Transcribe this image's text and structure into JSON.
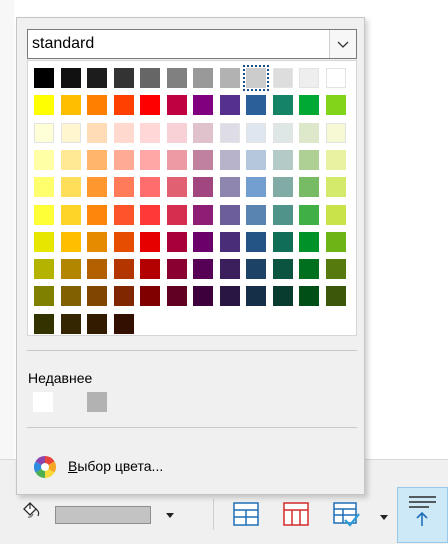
{
  "palette_selector": {
    "value": "standard",
    "chevron_icon": "chevron-down-icon"
  },
  "swatches": [
    [
      "#000000",
      "#111111",
      "#1c1c1c",
      "#333333",
      "#666666",
      "#808080",
      "#999999",
      "#b2b2b2",
      "#cccccc",
      "#dddddd",
      "#eeeeee",
      "#ffffff"
    ],
    [
      "#ffff00",
      "#ffbf00",
      "#ff8000",
      "#ff4000",
      "#ff0000",
      "#bf0041",
      "#800080",
      "#55308d",
      "#2a6099",
      "#158466",
      "#00a933",
      "#81d41a"
    ],
    [
      "#ffffd7",
      "#fff5ce",
      "#ffdbb6",
      "#ffd8ce",
      "#ffd7d7",
      "#f7d1d5",
      "#e0c2cd",
      "#dedce6",
      "#dee6ef",
      "#dee7e5",
      "#dde8cb",
      "#f6f9d4"
    ],
    [
      "#ffffa6",
      "#ffe994",
      "#ffb66c",
      "#ffaa95",
      "#ffa6a6",
      "#ec9ba4",
      "#bf819e",
      "#b7b3ca",
      "#b4c7dc",
      "#b3cac7",
      "#afd095",
      "#e8f2a1"
    ],
    [
      "#ffff6d",
      "#ffde59",
      "#ff972f",
      "#ff7b59",
      "#ff6d6d",
      "#e16173",
      "#a1467e",
      "#8e86ae",
      "#729fcf",
      "#81aca6",
      "#77bc65",
      "#d4ea6b"
    ],
    [
      "#ffff38",
      "#ffd428",
      "#ff860d",
      "#ff5429",
      "#ff3838",
      "#d62e4e",
      "#8d1d75",
      "#6b5e9b",
      "#5983b0",
      "#50938a",
      "#3faf46",
      "#c9e44b"
    ],
    [
      "#e6e600",
      "#ffbf00",
      "#e68a00",
      "#e64d00",
      "#e60000",
      "#a8003b",
      "#6b006b",
      "#4a2d78",
      "#245385",
      "#0f6e55",
      "#009129",
      "#6db514"
    ],
    [
      "#b3b300",
      "#b38600",
      "#b36000",
      "#b33600",
      "#b30000",
      "#8a0030",
      "#560056",
      "#3b1f5c",
      "#1c4266",
      "#0b5440",
      "#00701f",
      "#567a0e"
    ],
    [
      "#808000",
      "#806000",
      "#804500",
      "#802700",
      "#800000",
      "#610022",
      "#3d003d",
      "#2a1642",
      "#142f47",
      "#083c2e",
      "#004f16",
      "#3d570a"
    ],
    [
      "#333300",
      "#332600",
      "#331b00",
      "#330f00"
    ]
  ],
  "recent": {
    "label": "Недавнее",
    "colors": [
      "#ffffff",
      "#b2b2b2"
    ]
  },
  "picker": {
    "label_accel": "В",
    "label_rest": "ыбор цвета...",
    "icon": "color-wheel-icon"
  },
  "toolbar": {
    "fill_icon": "paint-bucket-icon",
    "current_color": "#c3c3c3",
    "icons": [
      "table-borders-icon",
      "table-red-borders-icon",
      "table-autoformat-icon",
      "align-top-icon"
    ]
  }
}
